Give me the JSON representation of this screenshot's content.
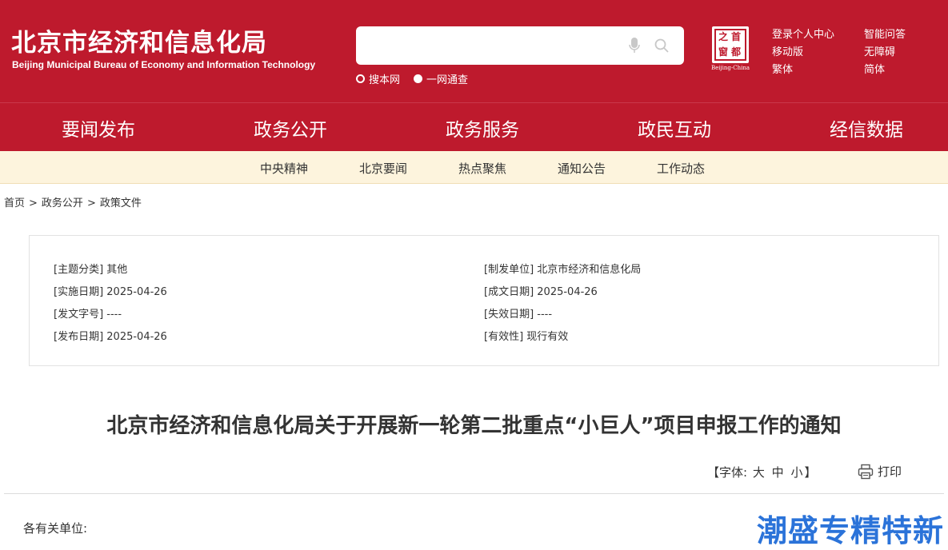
{
  "header": {
    "title": "北京市经济和信息化局",
    "subtitle": "Beijing Municipal Bureau of Economy and Information Technology",
    "search": {
      "placeholder": "",
      "scope_site": "搜本网",
      "scope_all": "一网通查"
    },
    "seal": {
      "chars": [
        "首",
        "都",
        "之",
        "窗"
      ],
      "caption": "Beijing-China"
    },
    "links": [
      "登录个人中心",
      "智能问答",
      "移动版",
      "无障碍",
      "繁体",
      "简体"
    ]
  },
  "main_nav": [
    "要闻发布",
    "政务公开",
    "政务服务",
    "政民互动",
    "经信数据"
  ],
  "sub_nav": [
    "中央精神",
    "北京要闻",
    "热点聚焦",
    "通知公告",
    "工作动态"
  ],
  "breadcrumb": [
    "首页",
    "政务公开",
    "政策文件"
  ],
  "meta": {
    "left": [
      "[主题分类] 其他",
      "[实施日期] 2025-04-26",
      "[发文字号] ----",
      "[发布日期] 2025-04-26"
    ],
    "right": [
      "[制发单位] 北京市经济和信息化局",
      "[成文日期] 2025-04-26",
      "[失效日期] ----",
      "[有效性] 现行有效"
    ]
  },
  "document": {
    "title": "北京市经济和信息化局关于开展新一轮第二批重点“小巨人”项目申报工作的通知",
    "font_tool": {
      "open": "【字体:",
      "large": "大",
      "medium": "中",
      "small": "小",
      "close": "】"
    },
    "print_label": "打印",
    "salutation": "各有关单位:"
  },
  "watermark": "潮盛专精特新",
  "colors": {
    "brand_red": "#be1a2d",
    "subnav_bg": "#fdf4dd",
    "watermark_blue": "#2b73d9"
  }
}
